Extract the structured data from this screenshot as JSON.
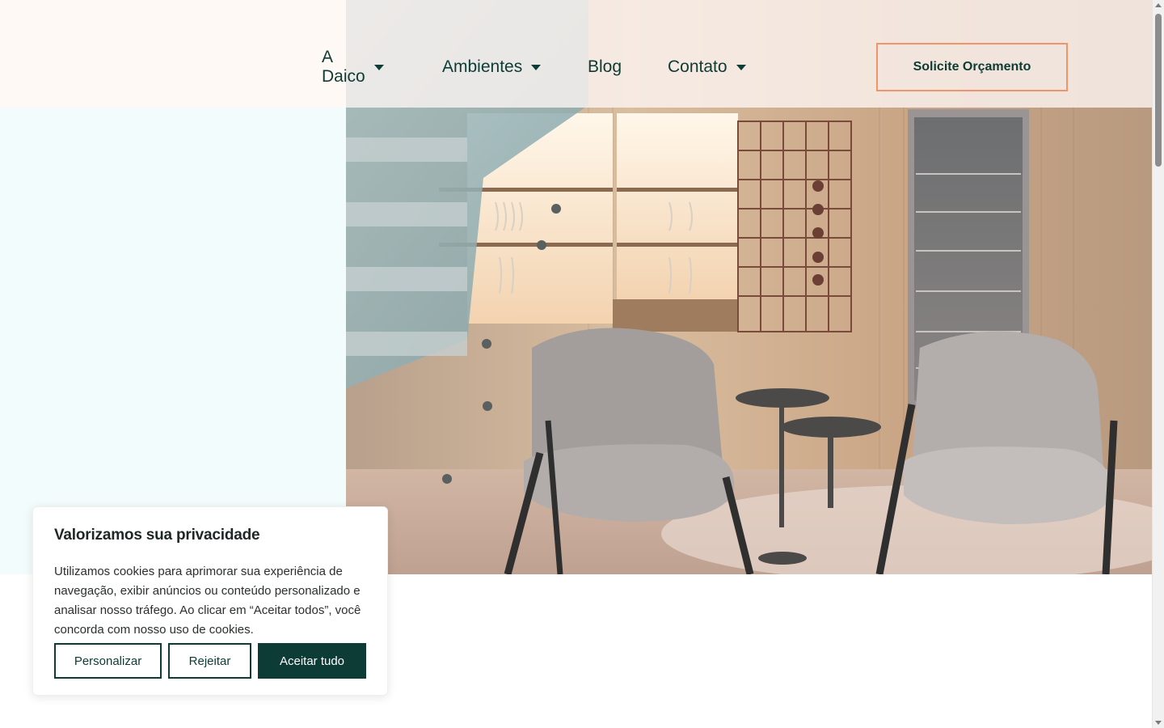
{
  "header": {
    "nav": [
      {
        "label": "A Daico",
        "has_dropdown": true
      },
      {
        "label": "Ambientes",
        "has_dropdown": true
      },
      {
        "label": "Blog",
        "has_dropdown": false
      },
      {
        "label": "Contato",
        "has_dropdown": true
      }
    ],
    "cta_label": "Solicite Orçamento"
  },
  "hero": {
    "image_description": "interior-living-room-chairs-wine-cellar"
  },
  "cookie_banner": {
    "title": "Valorizamos sua privacidade",
    "text": "Utilizamos cookies para aprimorar sua experiência de navegação, exibir anúncios ou conteúdo personalizado e analisar nosso tráfego. Ao clicar em “Aceitar todos”, você concorda com nosso uso de cookies.",
    "buttons": {
      "customize": "Personalizar",
      "reject": "Rejeitar",
      "accept": "Aceitar tudo"
    }
  },
  "colors": {
    "brand_dark": "#0d3b35",
    "accent_orange": "#f0956a",
    "left_panel": "#f3fcfc"
  }
}
